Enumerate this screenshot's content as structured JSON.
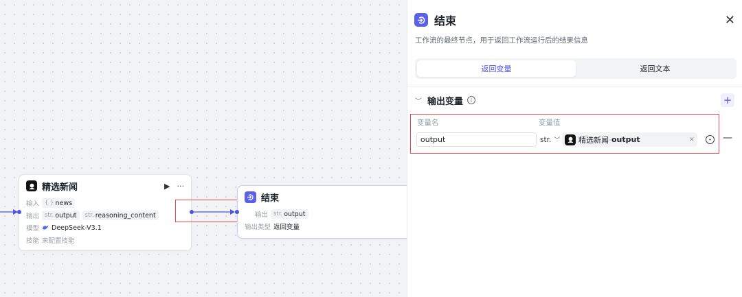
{
  "colors": {
    "accent": "#4f54e0",
    "highlight": "#e5484d",
    "end_logo": "#5a5fec"
  },
  "canvas": {
    "news_node": {
      "title": "精选新闻",
      "run_icon": "▶",
      "more_icon": "···",
      "input_label": "输入",
      "input_type": "{ }",
      "input_value": "news",
      "output_label": "输出",
      "outputs": [
        {
          "type": "str.",
          "name": "output"
        },
        {
          "type": "str.",
          "name": "reasoning_content"
        }
      ],
      "model_label": "模型",
      "model_value": "DeepSeek-V3.1",
      "skill_label": "技能",
      "skill_value": "未配置技能"
    },
    "end_node": {
      "title": "结束",
      "output_label": "输出",
      "output_type": "str.",
      "output_value": "output",
      "output_kind_label": "输出类型",
      "output_kind_value": "返回变量"
    }
  },
  "panel": {
    "title": "结束",
    "close_icon": "✕",
    "description": "工作流的最终节点，用于返回工作流运行后的结果信息",
    "tabs": [
      {
        "label": "返回变量",
        "active": true
      },
      {
        "label": "返回文本",
        "active": false
      }
    ],
    "section_title": "输出变量",
    "add_icon": "+",
    "col_name_label": "变量名",
    "col_value_label": "变量值",
    "variable": {
      "name": "output",
      "type": "str.",
      "ref_node": "精选新闻",
      "ref_sep": " - ",
      "ref_var": "output",
      "clear_icon": "×"
    },
    "remove_icon": "—"
  }
}
